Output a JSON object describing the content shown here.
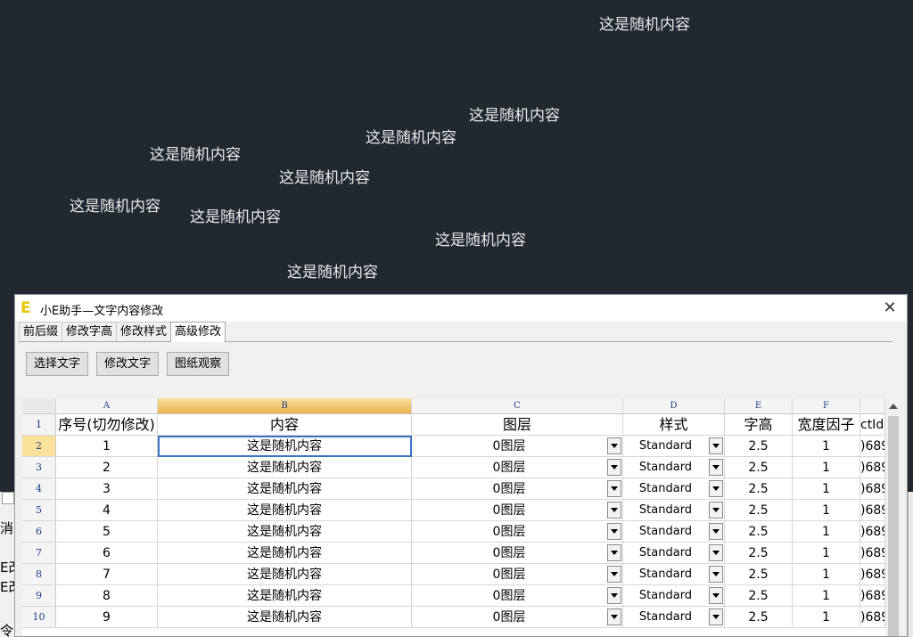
{
  "canvas": {
    "texts": [
      "这是随机内容",
      "这是随机内容",
      "这是随机内容",
      "这是随机内容",
      "这是随机内容",
      "这是随机内容",
      "这是随机内容",
      "这是随机内容",
      "这是随机内容"
    ]
  },
  "background": {
    "left_fragments": [
      "消",
      "E改",
      "E改",
      "令"
    ]
  },
  "dialog": {
    "title": "小E助手—文字内容修改",
    "icon_letter": "E",
    "close_symbol": "✕",
    "tabs": [
      {
        "label": "前后缀"
      },
      {
        "label": "修改字高"
      },
      {
        "label": "修改样式"
      },
      {
        "label": "高级修改"
      }
    ],
    "active_tab": 3,
    "buttons": {
      "select_text": "选择文字",
      "modify_text": "修改文字",
      "drawing_view": "图纸观察"
    },
    "grid": {
      "column_letters": [
        "A",
        "B",
        "C",
        "D",
        "E",
        "F",
        ""
      ],
      "headers": [
        "序号(切勿修改)",
        "内容",
        "图层",
        "样式",
        "字高",
        "宽度因子",
        "ctId"
      ],
      "rows": [
        {
          "num": "2",
          "seq": "1",
          "content": "这是随机内容",
          "layer": "0图层",
          "style": "Standard",
          "height": "2.5",
          "width": "1",
          "id": ")689"
        },
        {
          "num": "3",
          "seq": "2",
          "content": "这是随机内容",
          "layer": "0图层",
          "style": "Standard",
          "height": "2.5",
          "width": "1",
          "id": ")689"
        },
        {
          "num": "4",
          "seq": "3",
          "content": "这是随机内容",
          "layer": "0图层",
          "style": "Standard",
          "height": "2.5",
          "width": "1",
          "id": ")689"
        },
        {
          "num": "5",
          "seq": "4",
          "content": "这是随机内容",
          "layer": "0图层",
          "style": "Standard",
          "height": "2.5",
          "width": "1",
          "id": ")689"
        },
        {
          "num": "6",
          "seq": "5",
          "content": "这是随机内容",
          "layer": "0图层",
          "style": "Standard",
          "height": "2.5",
          "width": "1",
          "id": ")689"
        },
        {
          "num": "7",
          "seq": "6",
          "content": "这是随机内容",
          "layer": "0图层",
          "style": "Standard",
          "height": "2.5",
          "width": "1",
          "id": ")689"
        },
        {
          "num": "8",
          "seq": "7",
          "content": "这是随机内容",
          "layer": "0图层",
          "style": "Standard",
          "height": "2.5",
          "width": "1",
          "id": ")689"
        },
        {
          "num": "9",
          "seq": "8",
          "content": "这是随机内容",
          "layer": "0图层",
          "style": "Standard",
          "height": "2.5",
          "width": "1",
          "id": ")689"
        },
        {
          "num": "10",
          "seq": "9",
          "content": "这是随机内容",
          "layer": "0图层",
          "style": "Standard",
          "height": "2.5",
          "width": "1",
          "id": ")689"
        }
      ],
      "header_row_num": "1"
    }
  },
  "colors": {
    "canvas_bg": "#212830",
    "canvas_text": "#e8e8e8",
    "selected_header": "#eab24a",
    "active_cell_border": "#3b73c5",
    "icon_yellow": "#e6c800"
  }
}
